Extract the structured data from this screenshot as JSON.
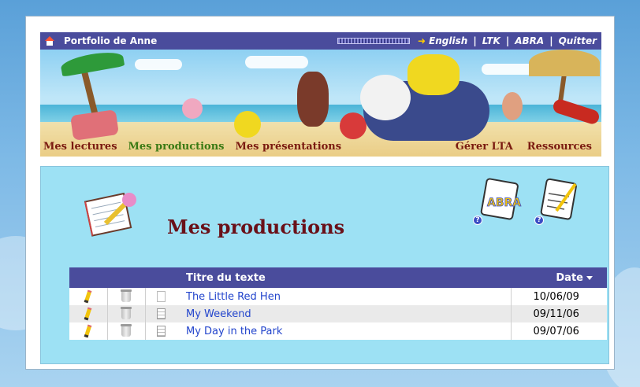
{
  "topbar": {
    "title": "Portfolio de Anne",
    "links": {
      "english": "English",
      "ltk": "LTK",
      "abra": "ABRA",
      "quitter": "Quitter"
    },
    "separator": "|"
  },
  "nav": {
    "items": [
      {
        "label": "Mes lectures"
      },
      {
        "label": "Mes productions",
        "active": true
      },
      {
        "label": "Mes présentations"
      },
      {
        "label": "Gérer LTA"
      },
      {
        "label": "Ressources"
      }
    ]
  },
  "page": {
    "title": "Mes productions",
    "help_glyph": "?"
  },
  "table": {
    "headers": {
      "title": "Titre du texte",
      "date": "Date"
    },
    "rows": [
      {
        "title": "The Little Red Hen",
        "date": "10/06/09",
        "doc_icon": "blank-document-icon"
      },
      {
        "title": "My Weekend",
        "date": "09/11/06",
        "doc_icon": "document-icon"
      },
      {
        "title": "My Day in the Park",
        "date": "09/07/06",
        "doc_icon": "document-icon"
      }
    ]
  },
  "colors": {
    "header_bar": "#4a4c9c",
    "panel": "#9de1f4",
    "title": "#6a1018",
    "nav_active": "#3a7a14",
    "nav_default": "#7a1a10",
    "link": "#2244cc"
  }
}
